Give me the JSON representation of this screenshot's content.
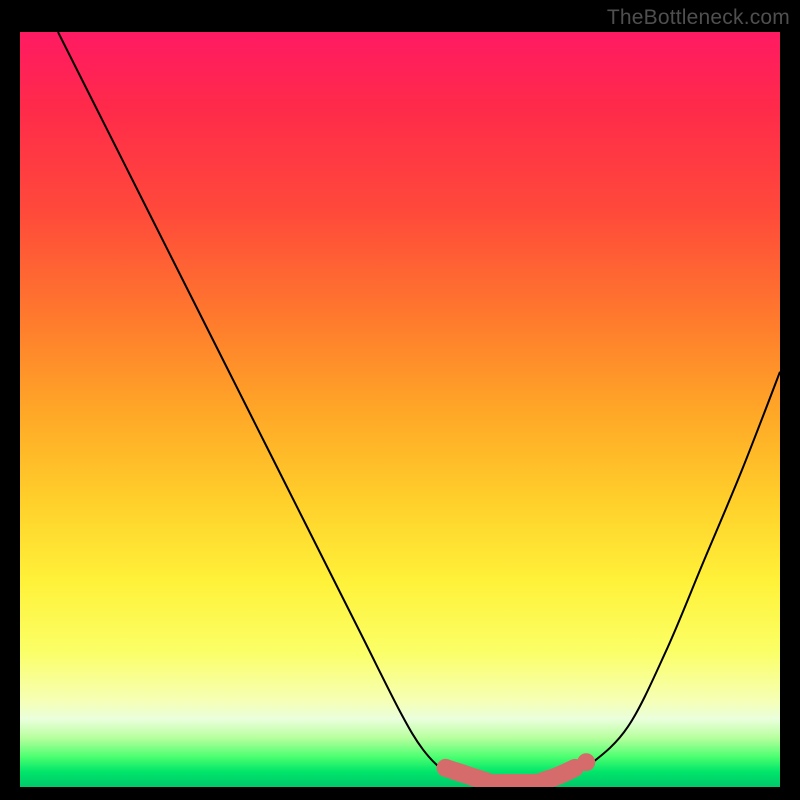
{
  "attribution": "TheBottleneck.com",
  "colors": {
    "marker": "#d66b6b",
    "curve": "#000000",
    "background": "#000000"
  },
  "chart_data": {
    "type": "line",
    "title": "",
    "xlabel": "",
    "ylabel": "",
    "xlim": [
      0,
      100
    ],
    "ylim": [
      0,
      100
    ],
    "grid": false,
    "legend": false,
    "series": [
      {
        "name": "bottleneck-curve",
        "x": [
          5,
          10,
          15,
          20,
          25,
          30,
          35,
          40,
          45,
          50,
          53,
          56,
          59,
          62,
          65,
          68,
          71,
          75,
          80,
          85,
          90,
          95,
          100
        ],
        "y": [
          100,
          90,
          80,
          70,
          60,
          50,
          40,
          30,
          20,
          10,
          5,
          2,
          1,
          0,
          0,
          0,
          1,
          3,
          8,
          18,
          30,
          42,
          55
        ]
      }
    ],
    "annotations": [
      {
        "name": "optimal-range-marker",
        "x_start": 56,
        "x_end": 73,
        "y": 0
      }
    ]
  }
}
